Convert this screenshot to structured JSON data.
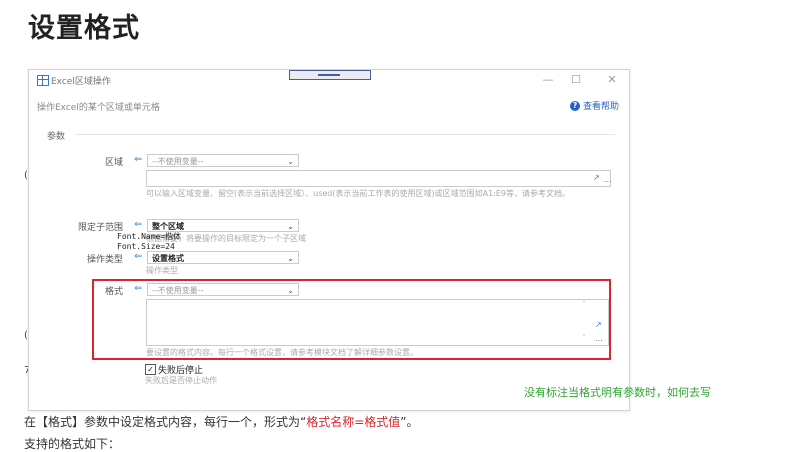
{
  "page": {
    "heading": "设置格式",
    "annotation": "没有标注当格式明有参数时，如何去写",
    "paragraph": {
      "prefix": "在【格式】参数中设定格式内容，每行一个，形式为“",
      "highlight": "格式名称=格式值",
      "suffix": "”。"
    },
    "paragraph2": "支持的格式如下："
  },
  "dialog": {
    "title": "Excel区域操作",
    "subtitle": "操作Excel的某个区域或单元格",
    "help_label": "查看帮助",
    "group_label": "参数",
    "fields": {
      "range": {
        "label": "区域",
        "variable_placeholder": "--不使用变量--",
        "hint": "可以输入区域变量、留空(表示当前选择区域）、used(表示当前工作表的使用区域)或区域范围如A1:E9等，请参考文档。"
      },
      "subrange": {
        "label": "限定子范围",
        "value": "整个区域",
        "hint": "根据需要，将要操作的目标限定为一个子区域"
      },
      "op_type": {
        "label": "操作类型",
        "value": "设置格式",
        "hint": "操作类型"
      },
      "format": {
        "label": "格式",
        "variable_placeholder": "--不使用变量--",
        "code_lines": [
          "Font.Name=楷体",
          "Font.Size=24"
        ],
        "hint": "要设置的格式内容。每行一个格式设置，请参考模块文档了解详细参数设置。"
      },
      "stop_on_fail": {
        "label": "失败后停止",
        "checked": true,
        "hint": "失败后是否停止动作"
      }
    }
  },
  "colors": {
    "highlight_red": "#e0232a",
    "annotation_green": "#2fa52f",
    "link_blue": "#2563c9"
  }
}
